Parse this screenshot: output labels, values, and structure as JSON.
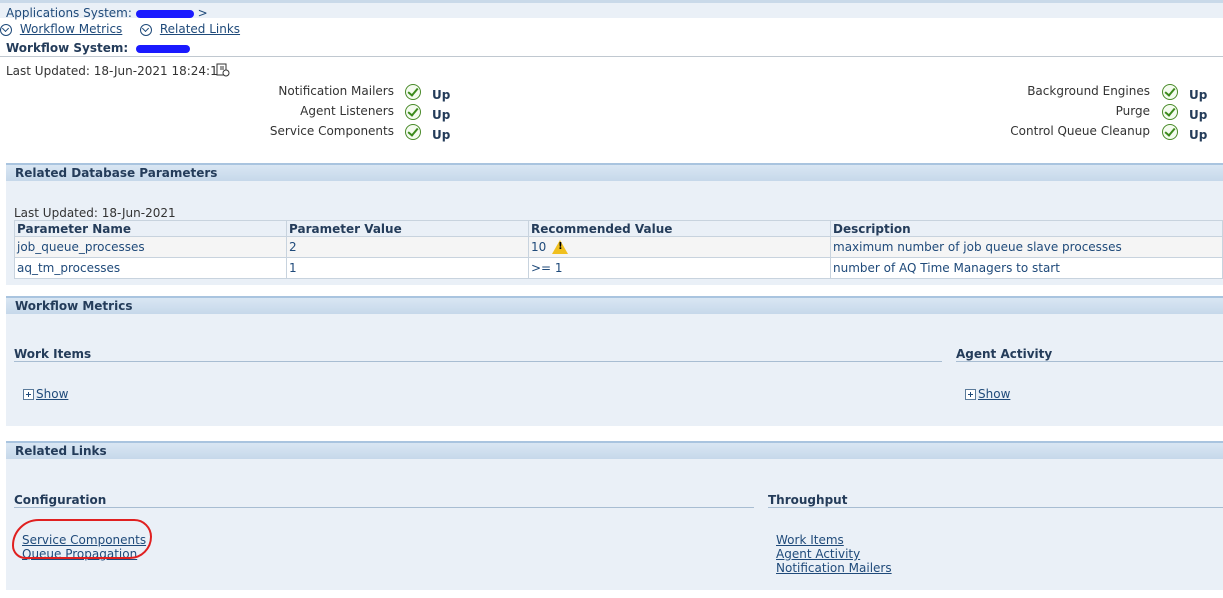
{
  "breadcrumb": {
    "label": "Applications System:",
    "suffix": ">"
  },
  "quick_links": [
    {
      "label": "Workflow Metrics"
    },
    {
      "label": "Related Links"
    }
  ],
  "workflow_system": {
    "label": "Workflow System:"
  },
  "last_updated": {
    "label": "Last Updated: 18-Jun-2021 18:24:14"
  },
  "status_left": [
    {
      "label": "Notification Mailers",
      "value": "Up"
    },
    {
      "label": "Agent Listeners",
      "value": "Up"
    },
    {
      "label": "Service Components",
      "value": "Up"
    }
  ],
  "status_right": [
    {
      "label": "Background Engines",
      "value": "Up"
    },
    {
      "label": "Purge",
      "value": "Up"
    },
    {
      "label": "Control Queue Cleanup",
      "value": "Up"
    }
  ],
  "db_params": {
    "title": "Related Database Parameters",
    "last_updated": "Last Updated: 18-Jun-2021",
    "columns": [
      "Parameter Name",
      "Parameter Value",
      "Recommended Value",
      "Description"
    ],
    "rows": [
      [
        "job_queue_processes",
        "2",
        "10",
        "maximum number of job queue slave processes"
      ],
      [
        "aq_tm_processes",
        "1",
        ">= 1",
        "number of AQ Time Managers to start"
      ]
    ]
  },
  "metrics": {
    "title": "Workflow Metrics",
    "work_items": {
      "title": "Work Items",
      "show": "Show"
    },
    "agent_activity": {
      "title": "Agent Activity",
      "show": "Show"
    }
  },
  "related_links": {
    "title": "Related Links",
    "configuration": {
      "title": "Configuration",
      "links": [
        "Service Components",
        "Queue Propagation"
      ]
    },
    "throughput": {
      "title": "Throughput",
      "links": [
        "Work Items",
        "Agent Activity",
        "Notification Mailers"
      ]
    }
  },
  "colors": {
    "accent": "#1f4a7a",
    "header_band": "#c6d8ea",
    "body_band": "#eaf0f7",
    "status_up": "#3c8a1c",
    "annotation": "#e02020"
  }
}
